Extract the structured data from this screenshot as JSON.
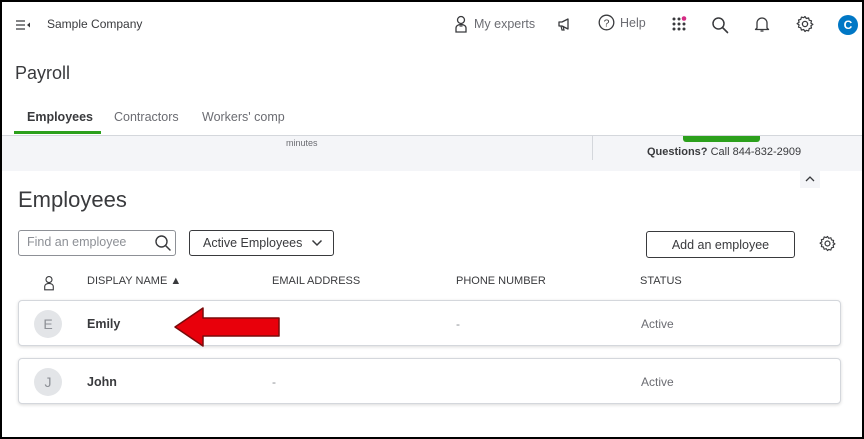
{
  "topbar": {
    "company": "Sample Company",
    "my_experts": "My experts",
    "help": "Help",
    "avatar_letter": "C"
  },
  "page": {
    "title": "Payroll"
  },
  "tabs": [
    {
      "label": "Employees",
      "active": true
    },
    {
      "label": "Contractors",
      "active": false
    },
    {
      "label": "Workers' comp",
      "active": false
    }
  ],
  "banner": {
    "minutes_text": "minutes",
    "questions_label": "Questions?",
    "questions_call": "Call 844-832-2909"
  },
  "employees": {
    "heading": "Employees",
    "search_placeholder": "Find an employee",
    "filter_label": "Active Employees",
    "add_button": "Add an employee",
    "columns": [
      "DISPLAY NAME ▲",
      "EMAIL ADDRESS",
      "PHONE NUMBER",
      "STATUS"
    ],
    "rows": [
      {
        "initial": "E",
        "name": "Emily",
        "email": "",
        "phone": "-",
        "status": "Active"
      },
      {
        "initial": "J",
        "name": "John",
        "email": "-",
        "phone": "",
        "status": "Active"
      }
    ]
  },
  "colors": {
    "accent_green": "#2ca01c",
    "brand_blue": "#0077c5",
    "arrow_red": "#e8000b"
  }
}
